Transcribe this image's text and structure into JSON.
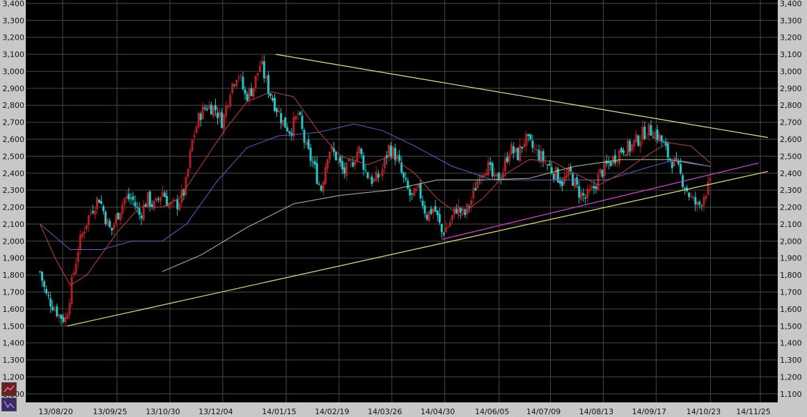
{
  "chart_data": {
    "type": "candlestick",
    "y_ticks": [
      1100,
      1200,
      1300,
      1400,
      1500,
      1600,
      1700,
      1800,
      1900,
      2000,
      2100,
      2200,
      2300,
      2400,
      2500,
      2600,
      2700,
      2800,
      2900,
      3000,
      3100,
      3200,
      3300,
      3400
    ],
    "y_tick_labels": [
      "1,100",
      "1,200",
      "1,300",
      "1,400",
      "1,500",
      "1,600",
      "1,700",
      "1,800",
      "1,900",
      "2,000",
      "2,100",
      "2,200",
      "2,300",
      "2,400",
      "2,500",
      "2,600",
      "2,700",
      "2,800",
      "2,900",
      "3,000",
      "3,100",
      "3,200",
      "3,300",
      "3,400"
    ],
    "ylim": [
      1050,
      3420
    ],
    "x_tick_labels": [
      "13/08/20",
      "13/09/25",
      "13/10/30",
      "13/12/04",
      "14/01/15",
      "14/02/19",
      "14/03/26",
      "14/04/30",
      "14/06/05",
      "14/07/09",
      "14/08/13",
      "14/09/17",
      "14/10/23",
      "14/11/25"
    ],
    "x_start": "2013-08-05",
    "x_tick_dates": [
      "2013-08-20",
      "2013-09-25",
      "2013-10-30",
      "2013-12-04",
      "2014-01-15",
      "2014-02-19",
      "2014-03-26",
      "2014-04-30",
      "2014-06-05",
      "2014-07-09",
      "2014-08-13",
      "2014-09-17",
      "2014-10-23",
      "2014-11-25"
    ],
    "candles_close_path": [
      [
        "2013-08-05",
        1820
      ],
      [
        "2013-08-09",
        1680
      ],
      [
        "2013-08-14",
        1620
      ],
      [
        "2013-08-18",
        1560
      ],
      [
        "2013-08-22",
        1540
      ],
      [
        "2013-08-26",
        1750
      ],
      [
        "2013-08-30",
        1950
      ],
      [
        "2013-09-04",
        2100
      ],
      [
        "2013-09-09",
        2200
      ],
      [
        "2013-09-13",
        2260
      ],
      [
        "2013-09-17",
        2150
      ],
      [
        "2013-09-21",
        2050
      ],
      [
        "2013-09-25",
        2150
      ],
      [
        "2013-09-30",
        2250
      ],
      [
        "2013-10-05",
        2250
      ],
      [
        "2013-10-10",
        2150
      ],
      [
        "2013-10-15",
        2250
      ],
      [
        "2013-10-20",
        2200
      ],
      [
        "2013-10-25",
        2300
      ],
      [
        "2013-10-30",
        2200
      ],
      [
        "2013-11-04",
        2220
      ],
      [
        "2013-11-09",
        2300
      ],
      [
        "2013-11-14",
        2600
      ],
      [
        "2013-11-19",
        2750
      ],
      [
        "2013-11-24",
        2800
      ],
      [
        "2013-11-29",
        2780
      ],
      [
        "2013-12-04",
        2700
      ],
      [
        "2013-12-09",
        2900
      ],
      [
        "2013-12-14",
        3000
      ],
      [
        "2013-12-19",
        2850
      ],
      [
        "2013-12-24",
        2900
      ],
      [
        "2013-12-29",
        3050
      ],
      [
        "2014-01-03",
        2900
      ],
      [
        "2014-01-08",
        2800
      ],
      [
        "2014-01-13",
        2700
      ],
      [
        "2014-01-18",
        2650
      ],
      [
        "2014-01-23",
        2750
      ],
      [
        "2014-01-28",
        2550
      ],
      [
        "2014-02-02",
        2450
      ],
      [
        "2014-02-07",
        2300
      ],
      [
        "2014-02-12",
        2550
      ],
      [
        "2014-02-17",
        2500
      ],
      [
        "2014-02-22",
        2400
      ],
      [
        "2014-02-27",
        2450
      ],
      [
        "2014-03-04",
        2550
      ],
      [
        "2014-03-09",
        2400
      ],
      [
        "2014-03-14",
        2350
      ],
      [
        "2014-03-19",
        2400
      ],
      [
        "2014-03-24",
        2550
      ],
      [
        "2014-03-29",
        2500
      ],
      [
        "2014-04-03",
        2350
      ],
      [
        "2014-04-08",
        2250
      ],
      [
        "2014-04-13",
        2300
      ],
      [
        "2014-04-18",
        2150
      ],
      [
        "2014-04-23",
        2200
      ],
      [
        "2014-04-28",
        2050
      ],
      [
        "2014-05-03",
        2100
      ],
      [
        "2014-05-08",
        2200
      ],
      [
        "2014-05-13",
        2150
      ],
      [
        "2014-05-18",
        2250
      ],
      [
        "2014-05-23",
        2400
      ],
      [
        "2014-05-28",
        2450
      ],
      [
        "2014-06-02",
        2350
      ],
      [
        "2014-06-07",
        2400
      ],
      [
        "2014-06-12",
        2550
      ],
      [
        "2014-06-17",
        2500
      ],
      [
        "2014-06-22",
        2600
      ],
      [
        "2014-06-27",
        2550
      ],
      [
        "2014-07-02",
        2500
      ],
      [
        "2014-07-07",
        2450
      ],
      [
        "2014-07-12",
        2400
      ],
      [
        "2014-07-17",
        2350
      ],
      [
        "2014-07-22",
        2400
      ],
      [
        "2014-07-27",
        2300
      ],
      [
        "2014-08-01",
        2250
      ],
      [
        "2014-08-06",
        2300
      ],
      [
        "2014-08-11",
        2400
      ],
      [
        "2014-08-16",
        2450
      ],
      [
        "2014-08-21",
        2500
      ],
      [
        "2014-08-26",
        2550
      ],
      [
        "2014-08-31",
        2550
      ],
      [
        "2014-09-05",
        2600
      ],
      [
        "2014-09-10",
        2650
      ],
      [
        "2014-09-15",
        2650
      ],
      [
        "2014-09-20",
        2600
      ],
      [
        "2014-09-25",
        2500
      ],
      [
        "2014-09-30",
        2450
      ],
      [
        "2014-10-05",
        2350
      ],
      [
        "2014-10-10",
        2250
      ],
      [
        "2014-10-15",
        2200
      ],
      [
        "2014-10-20",
        2300
      ],
      [
        "2014-10-23",
        2330
      ]
    ],
    "ma_short": [
      [
        "2013-08-05",
        2100
      ],
      [
        "2013-08-15",
        1900
      ],
      [
        "2013-08-25",
        1740
      ],
      [
        "2013-09-05",
        1800
      ],
      [
        "2013-09-25",
        2050
      ],
      [
        "2013-10-10",
        2200
      ],
      [
        "2013-10-25",
        2200
      ],
      [
        "2013-11-05",
        2250
      ],
      [
        "2013-11-20",
        2450
      ],
      [
        "2013-12-05",
        2650
      ],
      [
        "2013-12-20",
        2820
      ],
      [
        "2014-01-05",
        2880
      ],
      [
        "2014-01-20",
        2850
      ],
      [
        "2014-02-05",
        2650
      ],
      [
        "2014-02-20",
        2500
      ],
      [
        "2014-03-10",
        2450
      ],
      [
        "2014-03-25",
        2500
      ],
      [
        "2014-04-10",
        2400
      ],
      [
        "2014-04-25",
        2250
      ],
      [
        "2014-05-10",
        2150
      ],
      [
        "2014-05-25",
        2250
      ],
      [
        "2014-06-10",
        2400
      ],
      [
        "2014-06-25",
        2480
      ],
      [
        "2014-07-10",
        2470
      ],
      [
        "2014-07-25",
        2400
      ],
      [
        "2014-08-10",
        2330
      ],
      [
        "2014-08-25",
        2400
      ],
      [
        "2014-09-10",
        2500
      ],
      [
        "2014-09-25",
        2580
      ],
      [
        "2014-10-10",
        2560
      ],
      [
        "2014-10-23",
        2460
      ]
    ],
    "ma_mid": [
      [
        "2013-08-05",
        2100
      ],
      [
        "2013-08-25",
        1950
      ],
      [
        "2013-09-15",
        1950
      ],
      [
        "2013-10-05",
        2000
      ],
      [
        "2013-10-25",
        2000
      ],
      [
        "2013-11-10",
        2100
      ],
      [
        "2013-11-30",
        2350
      ],
      [
        "2013-12-20",
        2550
      ],
      [
        "2014-01-10",
        2620
      ],
      [
        "2014-02-05",
        2640
      ],
      [
        "2014-03-01",
        2690
      ],
      [
        "2014-03-20",
        2650
      ],
      [
        "2014-04-10",
        2560
      ],
      [
        "2014-05-05",
        2440
      ],
      [
        "2014-06-01",
        2360
      ],
      [
        "2014-06-25",
        2360
      ],
      [
        "2014-07-20",
        2360
      ],
      [
        "2014-08-15",
        2360
      ],
      [
        "2014-09-10",
        2430
      ],
      [
        "2014-09-30",
        2480
      ],
      [
        "2014-10-23",
        2440
      ]
    ],
    "ma_long": [
      [
        "2013-10-25",
        1820
      ],
      [
        "2013-11-20",
        1920
      ],
      [
        "2013-12-20",
        2080
      ],
      [
        "2014-01-20",
        2220
      ],
      [
        "2014-02-20",
        2270
      ],
      [
        "2014-03-25",
        2300
      ],
      [
        "2014-04-25",
        2360
      ],
      [
        "2014-05-25",
        2360
      ],
      [
        "2014-06-25",
        2370
      ],
      [
        "2014-07-25",
        2440
      ],
      [
        "2014-08-25",
        2480
      ],
      [
        "2014-09-25",
        2480
      ],
      [
        "2014-10-23",
        2440
      ]
    ],
    "trendlines": [
      {
        "points": [
          [
            "2013-08-23",
            1500
          ],
          [
            "2014-11-30",
            2410
          ]
        ],
        "color": "#e6e67a"
      },
      {
        "points": [
          [
            "2014-01-08",
            3100
          ],
          [
            "2014-11-30",
            2610
          ]
        ],
        "color": "#e6e67a"
      },
      {
        "points": [
          [
            "2014-04-28",
            2010
          ],
          [
            "2014-11-24",
            2460
          ]
        ],
        "color": "#e040e0"
      }
    ],
    "colors": {
      "background": "#000000",
      "grid": "#4a4a4a",
      "axis_panel": "#c8c8c8",
      "candle_up": "#b02020",
      "candle_down": "#20c8c8",
      "ma_short": "#c04040",
      "ma_mid": "#6060d0",
      "ma_long": "#a0d080"
    }
  }
}
